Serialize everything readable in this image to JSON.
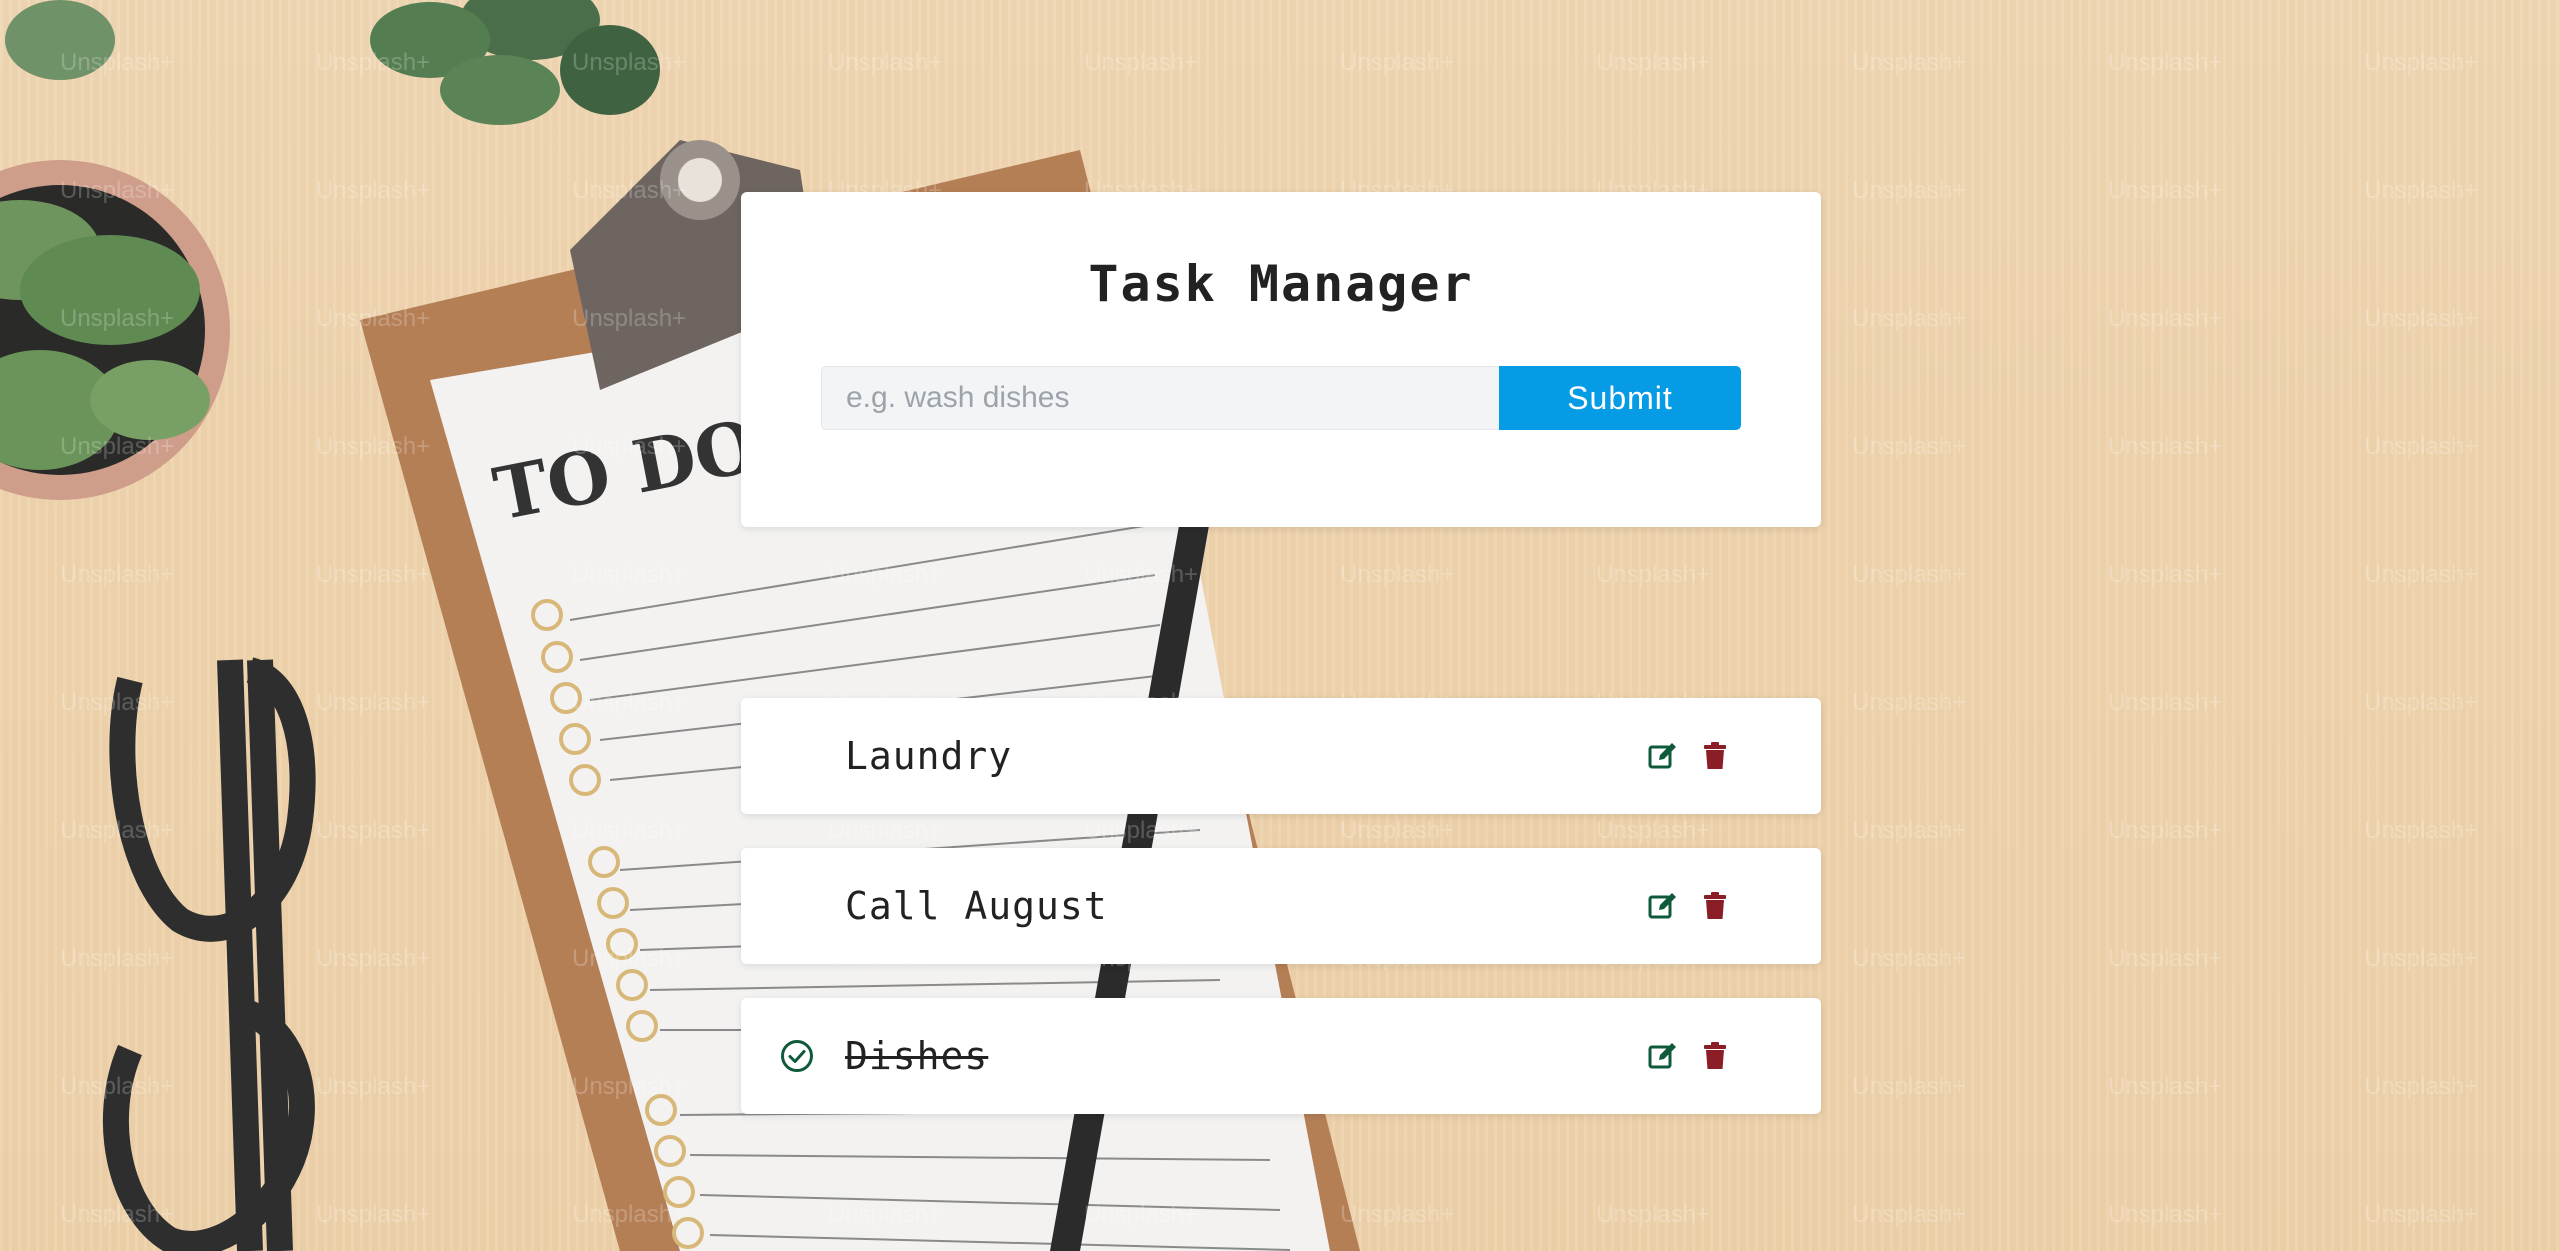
{
  "app": {
    "title": "Task Manager"
  },
  "form": {
    "input_placeholder": "e.g. wash dishes",
    "input_value": "",
    "submit_label": "Submit",
    "accent_color": "#069be5"
  },
  "tasks": [
    {
      "label": "Laundry",
      "completed": false
    },
    {
      "label": "Call August",
      "completed": false
    },
    {
      "label": "Dishes",
      "completed": true
    }
  ],
  "icons": {
    "edit": "edit-icon",
    "delete": "trash-icon",
    "completed": "check-circle-icon"
  },
  "colors": {
    "edit": "#0e5a3a",
    "delete": "#8b1d26",
    "completed": "#0e5a3a"
  },
  "background": {
    "description_words": [
      "TO DO:"
    ],
    "watermark": "Unsplash+"
  }
}
